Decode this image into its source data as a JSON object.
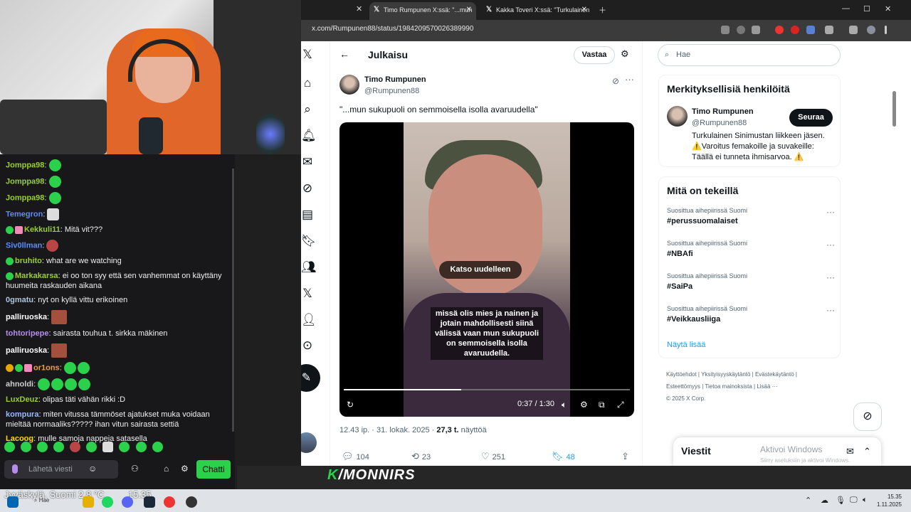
{
  "browser": {
    "tabs": [
      {
        "title": "Timo Rumpunen X:ssä: \"...mun",
        "active": true
      },
      {
        "title": "Kakka Toveri X:ssä: \"Turkulainen",
        "active": false
      }
    ],
    "url": "x.com/Rumpunen88/status/1984209570026389990"
  },
  "chat": {
    "messages": [
      {
        "user": "Jomppa98",
        "color": "#9acd32",
        "text": "",
        "emotes": [
          "green"
        ],
        "badges": []
      },
      {
        "user": "Jomppa98",
        "color": "#9acd32",
        "text": "",
        "emotes": [
          "green"
        ],
        "badges": []
      },
      {
        "user": "Jomppa98",
        "color": "#9acd32",
        "text": "",
        "emotes": [
          "green"
        ],
        "badges": []
      },
      {
        "user": "Temegron",
        "color": "#5b8cff",
        "text": "",
        "emotes": [
          "mute"
        ],
        "badges": []
      },
      {
        "user": "Kekkuli11",
        "color": "#9acd32",
        "text": "Mitä vit???",
        "emotes": [],
        "badges": [
          "green",
          "pink"
        ]
      },
      {
        "user": "Siv0llman",
        "color": "#5b8cff",
        "text": "",
        "emotes": [
          "av"
        ],
        "badges": []
      },
      {
        "user": "bruhito",
        "color": "#9acd32",
        "text": "what are we watching",
        "emotes": [],
        "badges": [
          "green"
        ]
      },
      {
        "user": "Markakarsa",
        "color": "#9acd32",
        "text": "ei oo ton syy että sen vanhemmat on käyttäny huumeita raskauden aikana",
        "emotes": [],
        "badges": [
          "green"
        ]
      },
      {
        "user": "0gmatu",
        "color": "#b0c4de",
        "text": "nyt on kyllä vittu erikoinen",
        "emotes": [],
        "badges": []
      },
      {
        "user": "palliruoska",
        "color": "#ffffff",
        "text": "",
        "emotes": [
          "img"
        ],
        "badges": []
      },
      {
        "user": "tohtoripepe",
        "color": "#b68cf0",
        "text": "sairasta touhua t. sirkka mäkinen",
        "emotes": [],
        "badges": []
      },
      {
        "user": "palliruoska",
        "color": "#ffffff",
        "text": "",
        "emotes": [
          "img"
        ],
        "badges": []
      },
      {
        "user": "or1ons",
        "color": "#f0a030",
        "text": "",
        "emotes": [
          "green",
          "green"
        ],
        "badges": [
          "gold",
          "green",
          "pink"
        ]
      },
      {
        "user": "ahnoldi",
        "color": "#cfcfcf",
        "text": "",
        "emotes": [
          "green",
          "green",
          "green",
          "green"
        ],
        "badges": []
      },
      {
        "user": "LuxDeuz",
        "color": "#9acd32",
        "text": "olipas täti vähän rikki :D",
        "emotes": [],
        "badges": []
      },
      {
        "user": "kompura",
        "color": "#9ab8ff",
        "text": "miten vitussa tämmöset ajatukset muka voidaan mieltää normaaliks????? ihan vitun sairasta settiä",
        "emotes": [],
        "badges": []
      },
      {
        "user": "Lacoog",
        "color": "#ffd700",
        "text": "mulle samoja nappeja satasella",
        "emotes": [],
        "badges": []
      }
    ],
    "input_placeholder": "Lähetä viesti",
    "chat_button": "Chatti"
  },
  "nav": [
    "x-logo-icon",
    "home-icon",
    "explore-icon",
    "notifications-icon",
    "messages-icon",
    "grok-icon",
    "lists-icon",
    "bookmarks-icon",
    "communities-icon",
    "premium-icon",
    "profile-icon",
    "more-icon"
  ],
  "post": {
    "header_title": "Julkaisu",
    "reply_button": "Vastaa",
    "author_name": "Timo Rumpunen",
    "author_handle": "@Rumpunen88",
    "text": "\"...mun sukupuoli on semmoisella isolla avaruudella\"",
    "video": {
      "replay_label": "Katso uudelleen",
      "caption": "missä olis mies ja nainen ja jotain mahdollisesti siinä välissä vaan mun sukupuoli on semmoisella isolla avaruudella.",
      "time": "0:37 / 1:30",
      "progress": 0.41
    },
    "timestamp": "12.43 ip. · 31. lokak. 2025 ·",
    "views_count": "27,3 t.",
    "views_label": "näyttöä",
    "replies": "104",
    "reposts": "23",
    "likes": "251",
    "bookmarks": "48"
  },
  "sidebar": {
    "search_placeholder": "Hae",
    "relevant": {
      "title": "Merkityksellisiä henkilöitä",
      "name": "Timo Rumpunen",
      "handle": "@Rumpunen88",
      "follow": "Seuraa",
      "bio": "Turkulainen Sinimustan liikkeen jäsen. ⚠️Varoitus femakoille ja suvakeille: Täällä ei tunneta ihmisarvoa. ⚠️"
    },
    "trends": {
      "title": "Mitä on tekeillä",
      "items": [
        {
          "context": "Suosittua aihepiirissä Suomi",
          "tag": "#perussuomalaiset"
        },
        {
          "context": "Suosittua aihepiirissä Suomi",
          "tag": "#NBAfi"
        },
        {
          "context": "Suosittua aihepiirissä Suomi",
          "tag": "#SaiPa"
        },
        {
          "context": "Suosittua aihepiirissä Suomi",
          "tag": "#Veikkausliiga"
        }
      ],
      "show_more": "Näytä lisää"
    },
    "footer_line1": "Käyttöehdot | Yksityisyyskäytäntö | Evästekäytäntö |",
    "footer_line2": "Esteettömyys | Tietoa mainoksista | Lisää ···",
    "footer_line3": "© 2025 X Corp."
  },
  "messages_drawer": "Viestit",
  "watermark": {
    "title": "Aktivoi Windows",
    "subtitle": "Siirry asetuksiin ja aktivoi Windows."
  },
  "stream_logo": {
    "k": "K",
    "rest": "/MONNIRS"
  },
  "taskbar": {
    "weather": "Jyväskylä, Suomi   2,8 °C",
    "weather_time": "15.35",
    "search": "Hae",
    "time": "15.35",
    "date": "1.11.2025"
  }
}
